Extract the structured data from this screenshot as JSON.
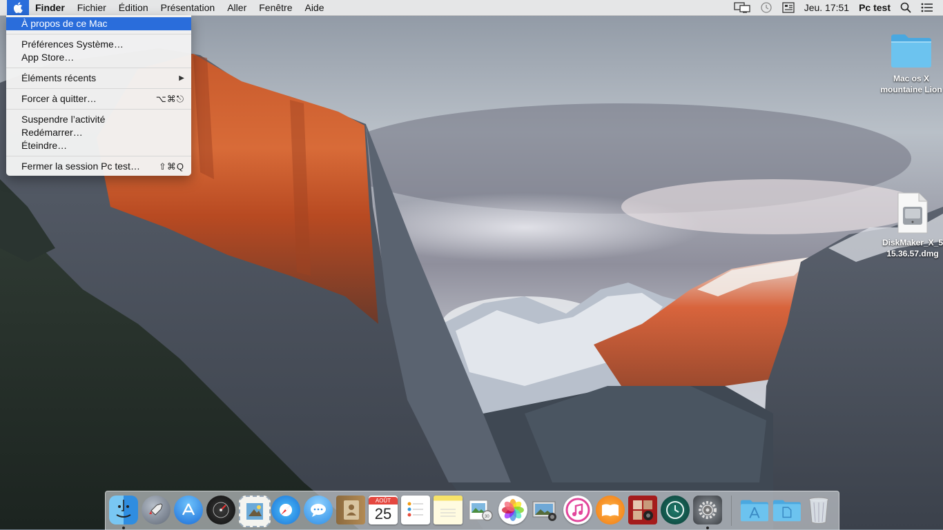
{
  "menubar": {
    "apple_icon": "apple-logo-icon",
    "items": [
      "Finder",
      "Fichier",
      "Édition",
      "Présentation",
      "Aller",
      "Fenêtre",
      "Aide"
    ],
    "status": {
      "airplay_icon": "airplay-display-icon",
      "timemachine_icon": "time-machine-icon",
      "keyboard_icon": "input-menu-icon",
      "clock": "Jeu. 17:51",
      "user": "Pc test",
      "search_icon": "spotlight-search-icon",
      "notif_icon": "notification-center-icon"
    }
  },
  "apple_menu": {
    "about": "À propos de ce Mac",
    "prefs": "Préférences Système…",
    "appstore": "App Store…",
    "recent": "Éléments récents",
    "force_quit": "Forcer à quitter…",
    "force_quit_shortcut": "⌥⌘⎋",
    "sleep": "Suspendre l’activité",
    "restart": "Redémarrer…",
    "shutdown": "Éteindre…",
    "logout": "Fermer la session Pc test…",
    "logout_shortcut": "⇧⌘Q"
  },
  "desktop": {
    "folder_label_1": "Mac os X",
    "folder_label_2": "mountaine Lion",
    "dmg_label_1": "DiskMaker_X_5",
    "dmg_label_2": "15.36.57.dmg"
  },
  "dock": {
    "calendar_month": "AOÛT",
    "calendar_day": "25",
    "apps": [
      "finder-icon",
      "launchpad-icon",
      "app-store-icon",
      "dashboard-icon",
      "mail-icon",
      "safari-icon",
      "messages-icon",
      "contacts-icon",
      "calendar-icon",
      "reminders-icon",
      "notes-icon",
      "preview-icon",
      "photos-icon",
      "image-capture-icon",
      "itunes-icon",
      "ibooks-icon",
      "photo-booth-icon",
      "time-machine-icon",
      "system-preferences-icon",
      "applications-folder-icon",
      "documents-folder-icon",
      "trash-icon"
    ]
  },
  "colors": {
    "accent": "#2a6ddb",
    "menu_bg": "#f3f3f3"
  }
}
